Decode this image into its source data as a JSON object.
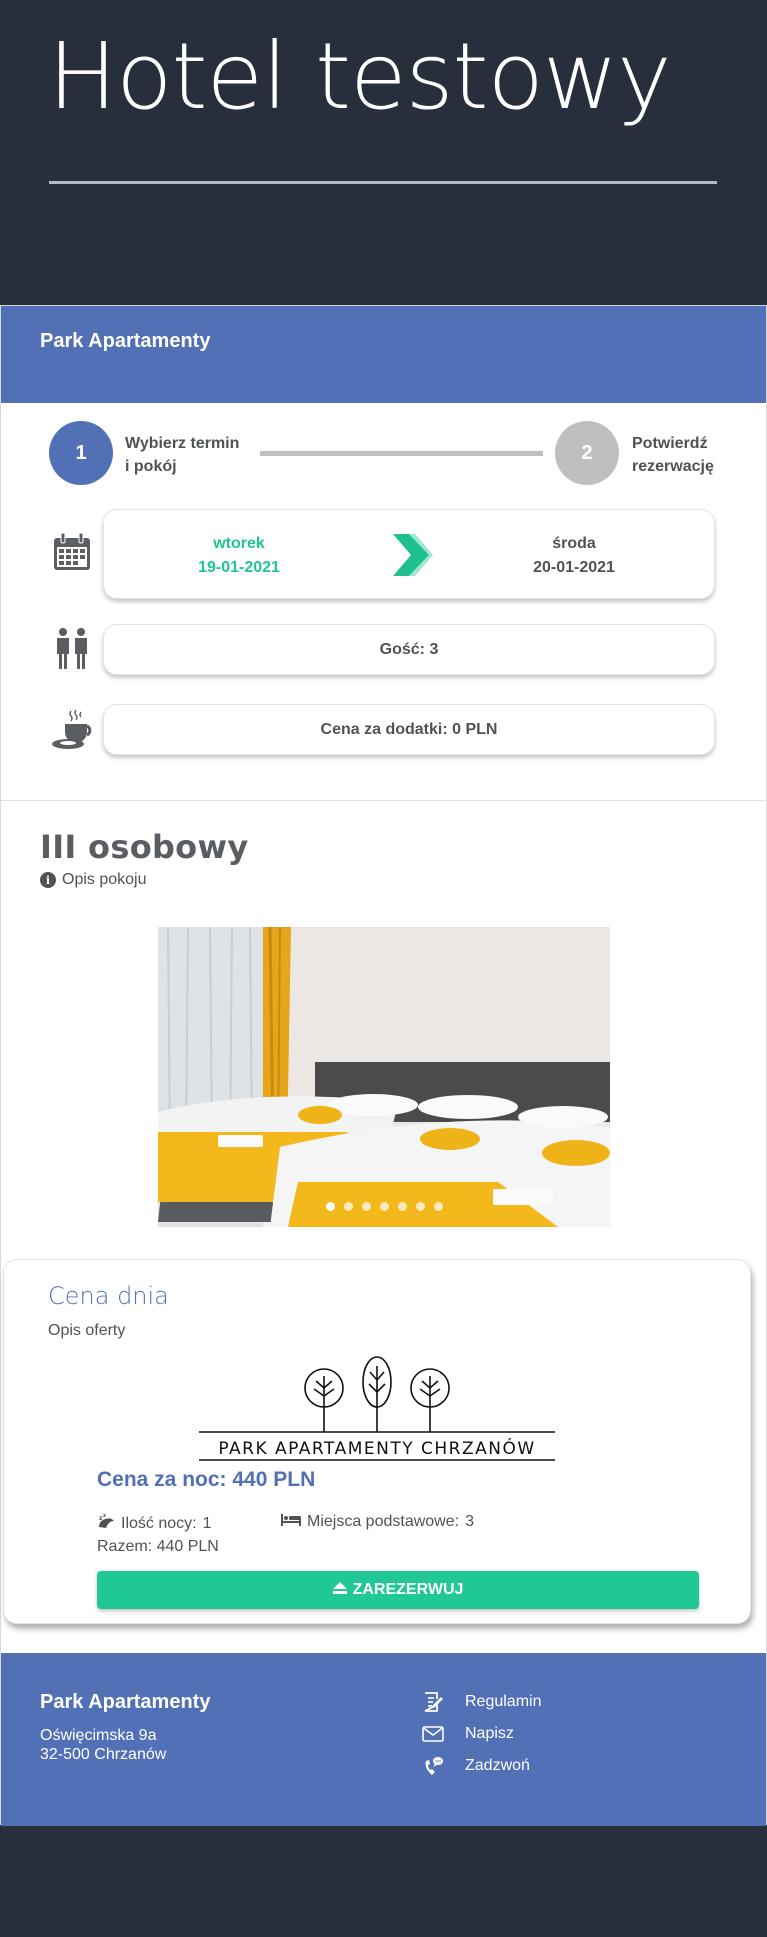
{
  "hero": {
    "title": "Hotel testowy"
  },
  "widget": {
    "brand": "Park Apartamenty",
    "steps": [
      {
        "number": "1",
        "label_line1": "Wybierz termin",
        "label_line2": "i pokój"
      },
      {
        "number": "2",
        "label_line1": "Potwierdź",
        "label_line2": "rezerwację"
      }
    ],
    "dates": {
      "from_day": "wtorek",
      "from_date": "19-01-2021",
      "to_day": "środa",
      "to_date": "20-01-2021"
    },
    "guests": "Gość: 3",
    "extras": "Cena za dodatki: 0 PLN",
    "icons": {
      "calendar": "calendar-icon",
      "guests": "people-icon",
      "extras": "coffee-icon"
    }
  },
  "room": {
    "title": "III osobowy",
    "description_link": "Opis pokoju",
    "gallery": {
      "slides": 7,
      "active_index": 0
    }
  },
  "offer": {
    "title": "Cena dnia",
    "description": "Opis oferty",
    "logo_text": "PARK APARTAMENTY CHRZANÓW",
    "price": "Cena za noc: 440 PLN",
    "nights_label": "Ilość nocy:",
    "nights_value": "1",
    "beds_label": "Miejsca podstawowe:",
    "beds_value": "3",
    "total": "Razem: 440 PLN",
    "book_button": "ZAREZERWUJ"
  },
  "footer": {
    "name": "Park Apartamenty",
    "address_line1": "Oświęcimska 9a",
    "address_line2": "32-500 Chrzanów",
    "links": [
      {
        "label": "Regulamin",
        "icon": "document-icon"
      },
      {
        "label": "Napisz",
        "icon": "envelope-icon"
      },
      {
        "label": "Zadzwoń",
        "icon": "phone-icon"
      }
    ]
  },
  "colors": {
    "background": "#272f3c",
    "brand_blue": "#5170b6",
    "accent_green": "#20c895",
    "text": "#4f5356",
    "inactive": "#bfbfbf"
  }
}
